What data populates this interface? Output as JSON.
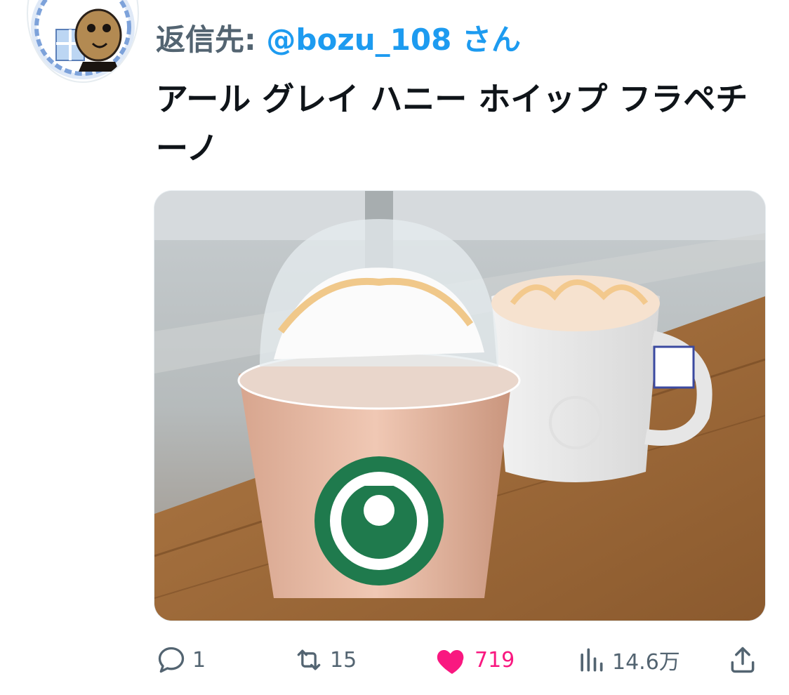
{
  "reply": {
    "prefix": "返信先:",
    "user": "@bozu_108",
    "suffix": "さん"
  },
  "tweet": {
    "text": "アール グレイ ハニー ホイップ フラペチーノ"
  },
  "actions": {
    "replies": "1",
    "retweets": "15",
    "likes": "719",
    "views": "14.6万"
  },
  "colors": {
    "accent": "#1d9bf0",
    "like": "#f91880",
    "muted": "#536471"
  },
  "icons": [
    "reply-icon",
    "retweet-icon",
    "heart-icon",
    "views-icon",
    "share-icon"
  ]
}
